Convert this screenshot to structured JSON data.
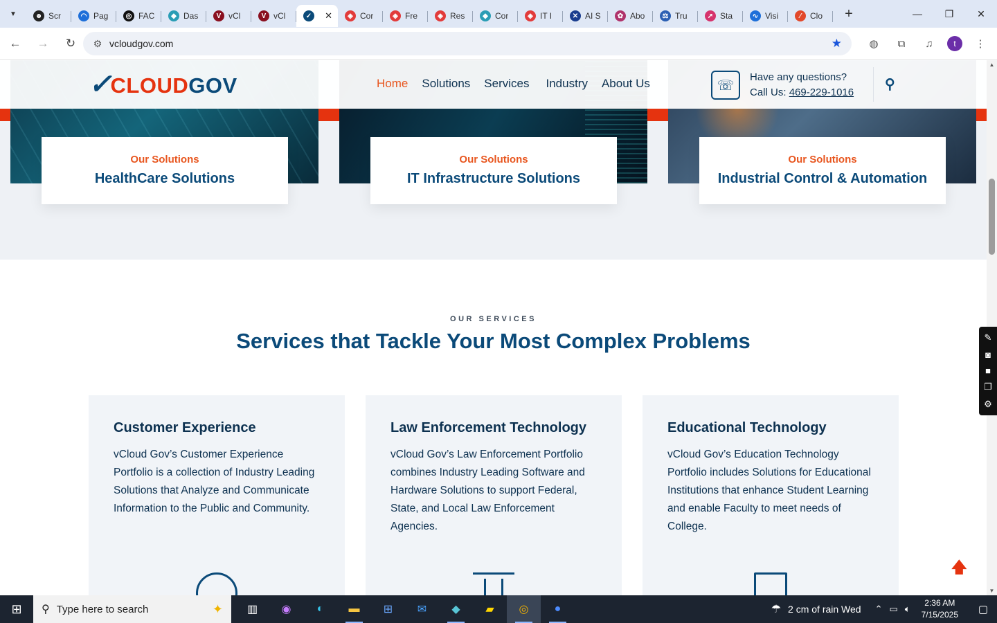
{
  "browser": {
    "tabs": [
      {
        "title": "Scr",
        "fav_color": "#222222",
        "fav_glyph": "☻"
      },
      {
        "title": "Pag",
        "fav_color": "#1e6fd9",
        "fav_glyph": "◠"
      },
      {
        "title": "FAC",
        "fav_color": "#111111",
        "fav_glyph": "◎"
      },
      {
        "title": "Das",
        "fav_color": "#2a9db5",
        "fav_glyph": "◆"
      },
      {
        "title": "vCl",
        "fav_color": "#8a1020",
        "fav_glyph": "V"
      },
      {
        "title": "vCl",
        "fav_color": "#8a1020",
        "fav_glyph": "V"
      },
      {
        "title": "",
        "fav_color": "#0b4a79",
        "fav_glyph": "✓",
        "active": true
      },
      {
        "title": "Cor",
        "fav_color": "#e23b3b",
        "fav_glyph": "◈"
      },
      {
        "title": "Fre",
        "fav_color": "#e23b3b",
        "fav_glyph": "◈"
      },
      {
        "title": "Res",
        "fav_color": "#e23b3b",
        "fav_glyph": "◈"
      },
      {
        "title": "Cor",
        "fav_color": "#2a9db5",
        "fav_glyph": "◆"
      },
      {
        "title": "IT I",
        "fav_color": "#e23b3b",
        "fav_glyph": "◈"
      },
      {
        "title": "AI S",
        "fav_color": "#1a3d8f",
        "fav_glyph": "✕"
      },
      {
        "title": "Abo",
        "fav_color": "#b0336b",
        "fav_glyph": "✿"
      },
      {
        "title": "Tru",
        "fav_color": "#2b5fb3",
        "fav_glyph": "⚖"
      },
      {
        "title": "Sta",
        "fav_color": "#d6336c",
        "fav_glyph": "➚"
      },
      {
        "title": "Visi",
        "fav_color": "#1e6fd9",
        "fav_glyph": "∿"
      },
      {
        "title": "Clo",
        "fav_color": "#e2482a",
        "fav_glyph": "⁄"
      }
    ],
    "active_tab_close": "✕",
    "new_tab": "+",
    "url": "vcloudgov.com"
  },
  "site": {
    "logo": {
      "mark": "✓",
      "word1": "CLOUD",
      "word2": "GOV"
    },
    "nav": [
      "Home",
      "Solutions",
      "Services",
      "Industry",
      "About Us"
    ],
    "contact": {
      "question": "Have any questions?",
      "call_label": "Call Us:",
      "phone": "469-229-1016"
    },
    "solutions": [
      {
        "kicker": "Our Solutions",
        "title": "HealthCare Solutions"
      },
      {
        "kicker": "Our Solutions",
        "title": "IT Infrastructure Solutions"
      },
      {
        "kicker": "Our Solutions",
        "title": "Industrial Control & Automation"
      }
    ],
    "services": {
      "kicker": "OUR SERVICES",
      "title": "Services that Tackle Your Most Complex Problems",
      "cards": [
        {
          "title": "Customer Experience",
          "text": "vCloud Gov’s Customer Experience Portfolio is a collection of Industry Leading Solutions that Analyze and Communicate Information to the Public and Community."
        },
        {
          "title": "Law Enforcement Technology",
          "text": "vCloud Gov’s Law Enforcement Portfolio combines Industry Leading Software and Hardware Solutions to support Federal, State, and Local Law Enforcement Agencies."
        },
        {
          "title": "Educational Technology",
          "text": "vCloud Gov’s Education Technology Portfolio includes Solutions for Educational Institutions that enhance Student Learning and enable Faculty to meet needs of College."
        }
      ]
    }
  },
  "taskbar": {
    "search_placeholder": "Type here to search",
    "weather": "2 cm of rain Wed",
    "time": "2:36 AM",
    "date": "7/15/2025"
  },
  "colors": {
    "brand_blue": "#0b4a79",
    "brand_red": "#e5330f",
    "accent_orange": "#e8561f"
  }
}
